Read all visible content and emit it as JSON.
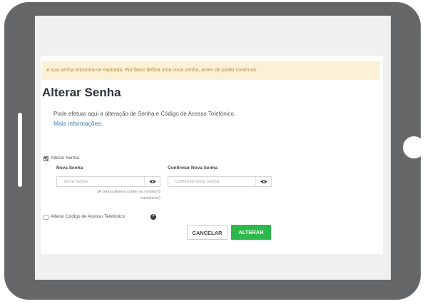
{
  "alert": {
    "text": "A sua senha encontra-se expirada. Por favor defina uma nova senha, antes de poder continuar."
  },
  "page": {
    "title": "Alterar Senha",
    "description": "Pode efetuar aqui a alteração de Senha e Código de Acesso Telefónico.",
    "more_info_link": "Mais informações."
  },
  "change_password": {
    "checkbox_label": "Alterar Senha",
    "checked": true,
    "new_password": {
      "label": "Nova Senha",
      "placeholder": "Nova Senha",
      "value": ""
    },
    "confirm_password": {
      "label": "Confirmar Nova Senha",
      "placeholder": "Confirmar Nova Senha",
      "value": ""
    },
    "hint_line1": "(A senha deverá conter no mínimo 8",
    "hint_line2": "caracteres)"
  },
  "change_phone_code": {
    "checkbox_label": "Alterar Código de Acesso Telefónico",
    "checked": false
  },
  "actions": {
    "cancel_label": "CANCELAR",
    "submit_label": "ALTERAR"
  },
  "colors": {
    "tablet_frame": "#666768",
    "alert_bg": "#fcf1d6",
    "alert_text": "#b08a3a",
    "link": "#2d7fc0",
    "submit_button": "#2cb94a"
  },
  "icons": {
    "password_toggle": "eye-icon",
    "help": "question-circle-icon",
    "checkbox_checked": "checkmark-icon"
  }
}
